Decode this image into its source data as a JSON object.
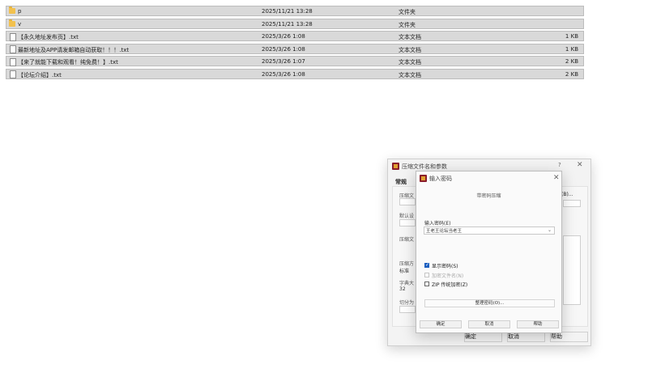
{
  "files": [
    {
      "name": "p",
      "date": "2025/11/21 13:28",
      "type": "文件夹",
      "size": "",
      "icon": "folder-icon"
    },
    {
      "name": "v",
      "date": "2025/11/21 13:28",
      "type": "文件夹",
      "size": "",
      "icon": "folder-icon"
    },
    {
      "name": "【永久地址发布页】.txt",
      "date": "2025/3/26 1:08",
      "type": "文本文档",
      "size": "1 KB",
      "icon": "text-file-icon"
    },
    {
      "name": "最新地址及APP请发邮箱自动获取！！！.txt",
      "date": "2025/3/26 1:08",
      "type": "文本文档",
      "size": "1 KB",
      "icon": "text-file-icon"
    },
    {
      "name": "【来了就能下载和观看！纯免费！】.txt",
      "date": "2025/3/26 1:07",
      "type": "文本文档",
      "size": "2 KB",
      "icon": "text-file-icon"
    },
    {
      "name": "【论坛介绍】.txt",
      "date": "2025/3/26 1:08",
      "type": "文本文档",
      "size": "2 KB",
      "icon": "text-file-icon"
    }
  ],
  "archive_dialog": {
    "title": "压缩文件名和参数",
    "help": "?",
    "close": "✕",
    "tab_general": "常规",
    "browse_suffix": "(B)...",
    "buttons": {
      "ok": "确定",
      "cancel": "取消",
      "help": "帮助"
    }
  },
  "password_dialog": {
    "title": "输入密码",
    "close": "✕",
    "header": "带密码压缩",
    "password_label": "输入密码(E)",
    "password_value": "王老王论坛当老王",
    "show_password": "显示密码(S)",
    "encrypt_filenames": "加密文件名(N)",
    "zip_legacy": "ZIP 传统加密(Z)",
    "organize_passwords": "整理密码(O)...",
    "ok": "确定",
    "cancel": "取消",
    "help": "帮助",
    "accent_color": "#1b5ebf"
  }
}
